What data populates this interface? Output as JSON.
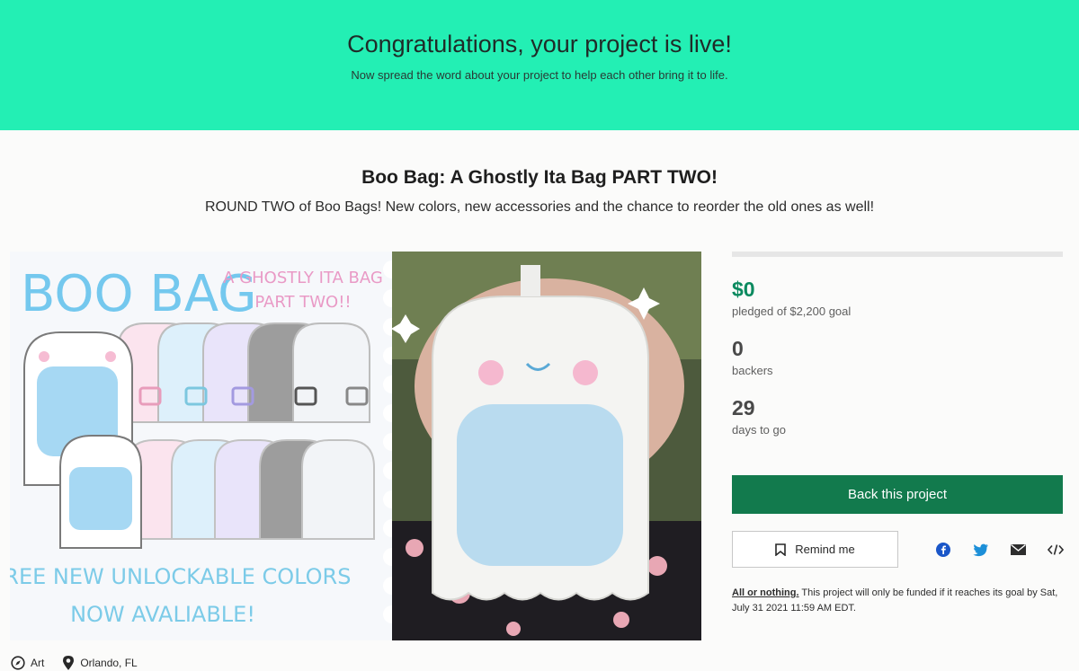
{
  "banner": {
    "title": "Congratulations, your project is live!",
    "subtitle": "Now spread the word about your project to help each other bring it to life."
  },
  "project": {
    "title": "Boo Bag: A Ghostly Ita Bag PART TWO!",
    "blurb": "ROUND TWO of Boo Bags! New colors, new accessories and the chance to reorder the old ones as well!",
    "category": "Art",
    "location": "Orlando, FL"
  },
  "media": {
    "art_title": "BOO BAG",
    "art_subtitle_1": "A GHOSTLY ITA BAG",
    "art_subtitle_2": "PART TWO!!",
    "art_caption_1": "THREE NEW UNLOCKABLE COLORS",
    "art_caption_2": "NOW AVALIABLE!"
  },
  "stats": {
    "pledged": "$0",
    "pledged_label": "pledged of $2,200 goal",
    "pledged_fraction": 0,
    "backers": "0",
    "backers_label": "backers",
    "days": "29",
    "days_label": "days to go"
  },
  "actions": {
    "back_label": "Back this project",
    "remind_label": "Remind me",
    "share_icons": [
      "facebook-icon",
      "twitter-icon",
      "email-icon",
      "embed-icon"
    ]
  },
  "funding_note": {
    "link": "All or nothing.",
    "text": " This project will only be funded if it reaches its goal by Sat, July 31 2021 11:59 AM EDT."
  },
  "colors": {
    "banner": "#23efb4",
    "accent": "#0b8a5f",
    "button": "#127a4d"
  }
}
